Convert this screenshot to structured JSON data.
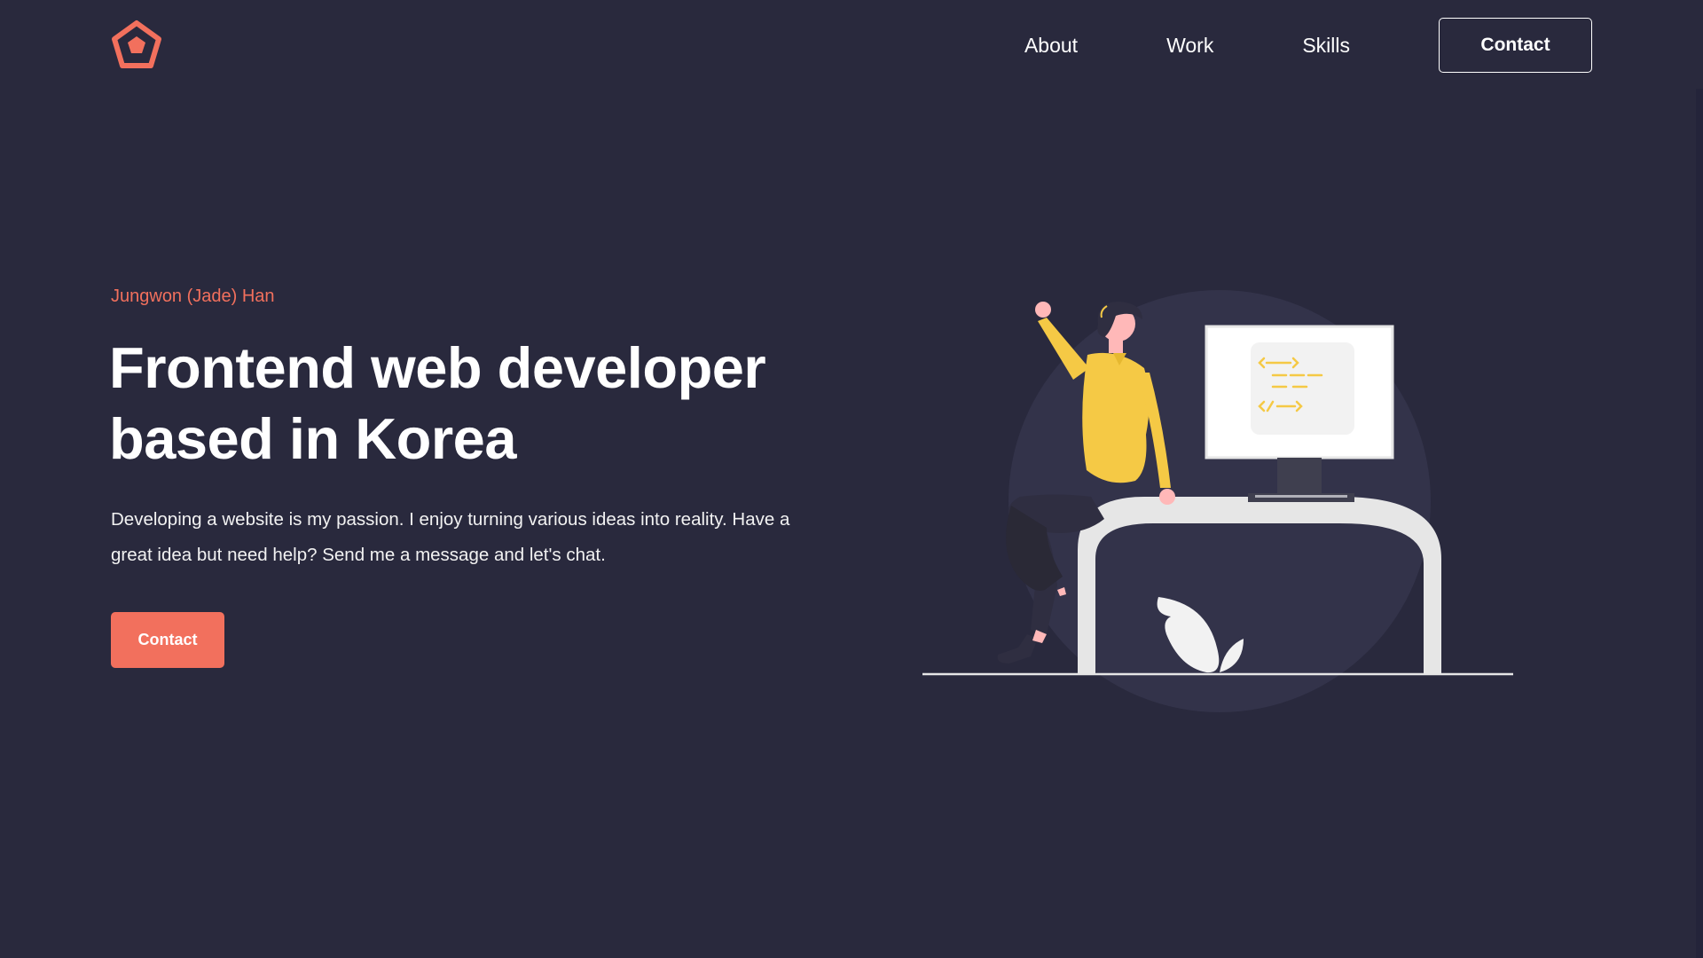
{
  "brand": {
    "logo_icon": "pentagon-logo-icon",
    "accent_color": "#f2705d"
  },
  "nav": {
    "items": [
      {
        "label": "About"
      },
      {
        "label": "Work"
      },
      {
        "label": "Skills"
      }
    ],
    "contact_label": "Contact"
  },
  "hero": {
    "name": "Jungwon (Jade) Han",
    "headline_line1": "Frontend web developer",
    "headline_line2": "based in Korea",
    "description_line1": "Developing a website is my passion. I enjoy turning various ideas into reality. Have a",
    "description_line2": "great idea but need help? Send me a message and let's chat.",
    "contact_label": "Contact"
  },
  "illustration": {
    "icon": "developer-at-desk-illustration",
    "background_color": "#29293d",
    "circle_color": "#33334a",
    "shirt_color": "#f5c945",
    "desk_color": "#e6e6e6"
  }
}
